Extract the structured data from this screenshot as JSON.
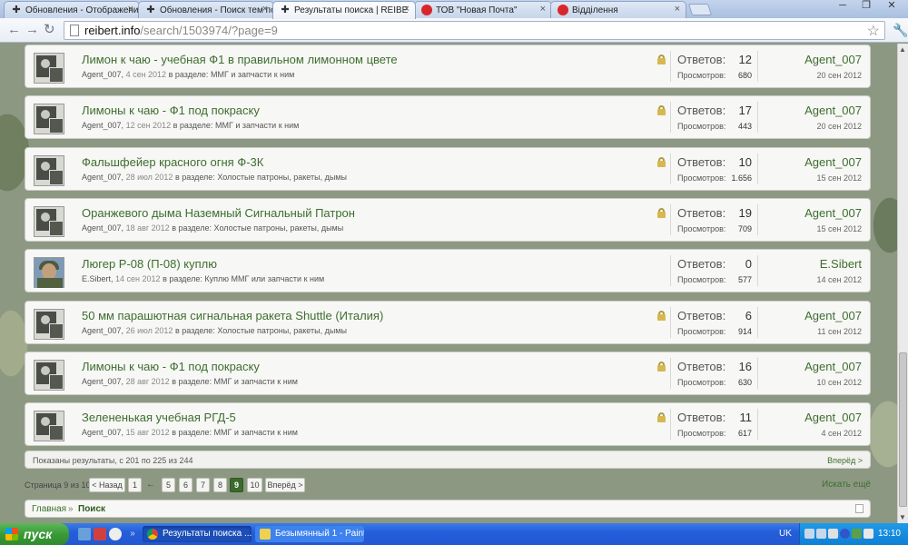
{
  "browser": {
    "tabs": [
      {
        "label": "Обновления - Отображени",
        "icon": "iron-cross-icon",
        "active": false
      },
      {
        "label": "Обновления - Поиск тем по",
        "icon": "iron-cross-icon",
        "active": false
      },
      {
        "label": "Результаты поиска | REIBE",
        "icon": "iron-cross-icon",
        "active": true
      },
      {
        "label": "ТОВ \"Новая Почта\"",
        "icon": "nova-poshta-icon",
        "active": false
      },
      {
        "label": "Відділення",
        "icon": "nova-poshta-icon",
        "active": false
      }
    ],
    "url_host": "reibert.info",
    "url_path": "/search/1503974/?page=9",
    "window_controls": [
      "─",
      "❐",
      "✕"
    ]
  },
  "results": [
    {
      "title": "Лимон к чаю - учебная Ф1 в правильном лимонном цвете",
      "author": "Agent_007",
      "date": "4 сен 2012",
      "in_section": "в разделе:",
      "forum": "ММГ и запчасти к ним",
      "locked": true,
      "replies_label": "Ответов:",
      "replies": "12",
      "views_label": "Просмотров:",
      "views": "680",
      "last_user": "Agent_007",
      "last_date": "20 сен 2012",
      "avatar": "grey"
    },
    {
      "title": "Лимоны к чаю - Ф1 под покраску",
      "author": "Agent_007",
      "date": "12 сен 2012",
      "in_section": "в разделе:",
      "forum": "ММГ и запчасти к ним",
      "locked": true,
      "replies_label": "Ответов:",
      "replies": "17",
      "views_label": "Просмотров:",
      "views": "443",
      "last_user": "Agent_007",
      "last_date": "20 сен 2012",
      "avatar": "grey"
    },
    {
      "title": "Фальшфейер красного огня Ф-3К",
      "author": "Agent_007",
      "date": "28 июл 2012",
      "in_section": "в разделе:",
      "forum": "Холостые патроны, ракеты, дымы",
      "locked": true,
      "replies_label": "Ответов:",
      "replies": "10",
      "views_label": "Просмотров:",
      "views": "1.656",
      "last_user": "Agent_007",
      "last_date": "15 сен 2012",
      "avatar": "grey"
    },
    {
      "title": "Оранжевого дыма Наземный Сигнальный Патрон",
      "author": "Agent_007",
      "date": "18 авг 2012",
      "in_section": "в разделе:",
      "forum": "Холостые патроны, ракеты, дымы",
      "locked": true,
      "replies_label": "Ответов:",
      "replies": "19",
      "views_label": "Просмотров:",
      "views": "709",
      "last_user": "Agent_007",
      "last_date": "15 сен 2012",
      "avatar": "grey"
    },
    {
      "title": "Люгер Р-08 (П-08) куплю",
      "author": "E.Sibert",
      "date": "14 сен 2012",
      "in_section": "в разделе:",
      "forum": "Куплю ММГ или запчасти к ним",
      "locked": false,
      "replies_label": "Ответов:",
      "replies": "0",
      "views_label": "Просмотров:",
      "views": "577",
      "last_user": "E.Sibert",
      "last_date": "14 сен 2012",
      "avatar": "photo"
    },
    {
      "title": "50 мм парашютная сигнальная ракета Shuttle (Италия)",
      "author": "Agent_007",
      "date": "26 июл 2012",
      "in_section": "в разделе:",
      "forum": "Холостые патроны, ракеты, дымы",
      "locked": true,
      "replies_label": "Ответов:",
      "replies": "6",
      "views_label": "Просмотров:",
      "views": "914",
      "last_user": "Agent_007",
      "last_date": "11 сен 2012",
      "avatar": "grey"
    },
    {
      "title": "Лимоны к чаю - Ф1 под покраску",
      "author": "Agent_007",
      "date": "28 авг 2012",
      "in_section": "в разделе:",
      "forum": "ММГ и запчасти к ним",
      "locked": true,
      "replies_label": "Ответов:",
      "replies": "16",
      "views_label": "Просмотров:",
      "views": "630",
      "last_user": "Agent_007",
      "last_date": "10 сен 2012",
      "avatar": "grey"
    },
    {
      "title": "Зелененькая учебная РГД-5",
      "author": "Agent_007",
      "date": "15 авг 2012",
      "in_section": "в разделе:",
      "forum": "ММГ и запчасти к ним",
      "locked": true,
      "replies_label": "Ответов:",
      "replies": "11",
      "views_label": "Просмотров:",
      "views": "617",
      "last_user": "Agent_007",
      "last_date": "4 сен 2012",
      "avatar": "grey"
    }
  ],
  "summary": {
    "text": "Показаны результаты, с 201 по 225 из 244",
    "next": "Вперёд >"
  },
  "pagination": {
    "label": "Страница 9 из 10",
    "prev": "< Назад",
    "pages": [
      "1",
      "←",
      "5",
      "6",
      "7",
      "8",
      "9",
      "10"
    ],
    "current": "9",
    "next": "Вперёд >",
    "search_more": "Искать ещё"
  },
  "breadcrumb": {
    "home": "Главная",
    "sep": "»",
    "current": "Поиск"
  },
  "taskbar": {
    "start": "пуск",
    "tasks": [
      {
        "label": "Результаты поиска ...",
        "icon": "chrome-icon",
        "active": true
      },
      {
        "label": "Безымянный 1 - Paint",
        "icon": "paint-icon",
        "active": false
      }
    ],
    "lang": "UK",
    "clock": "13:10"
  },
  "colors": {
    "accent": "#3d6e2e",
    "current_page": "#3b6a2c",
    "taskbar": "#245edb",
    "start": "#3a9a38"
  }
}
